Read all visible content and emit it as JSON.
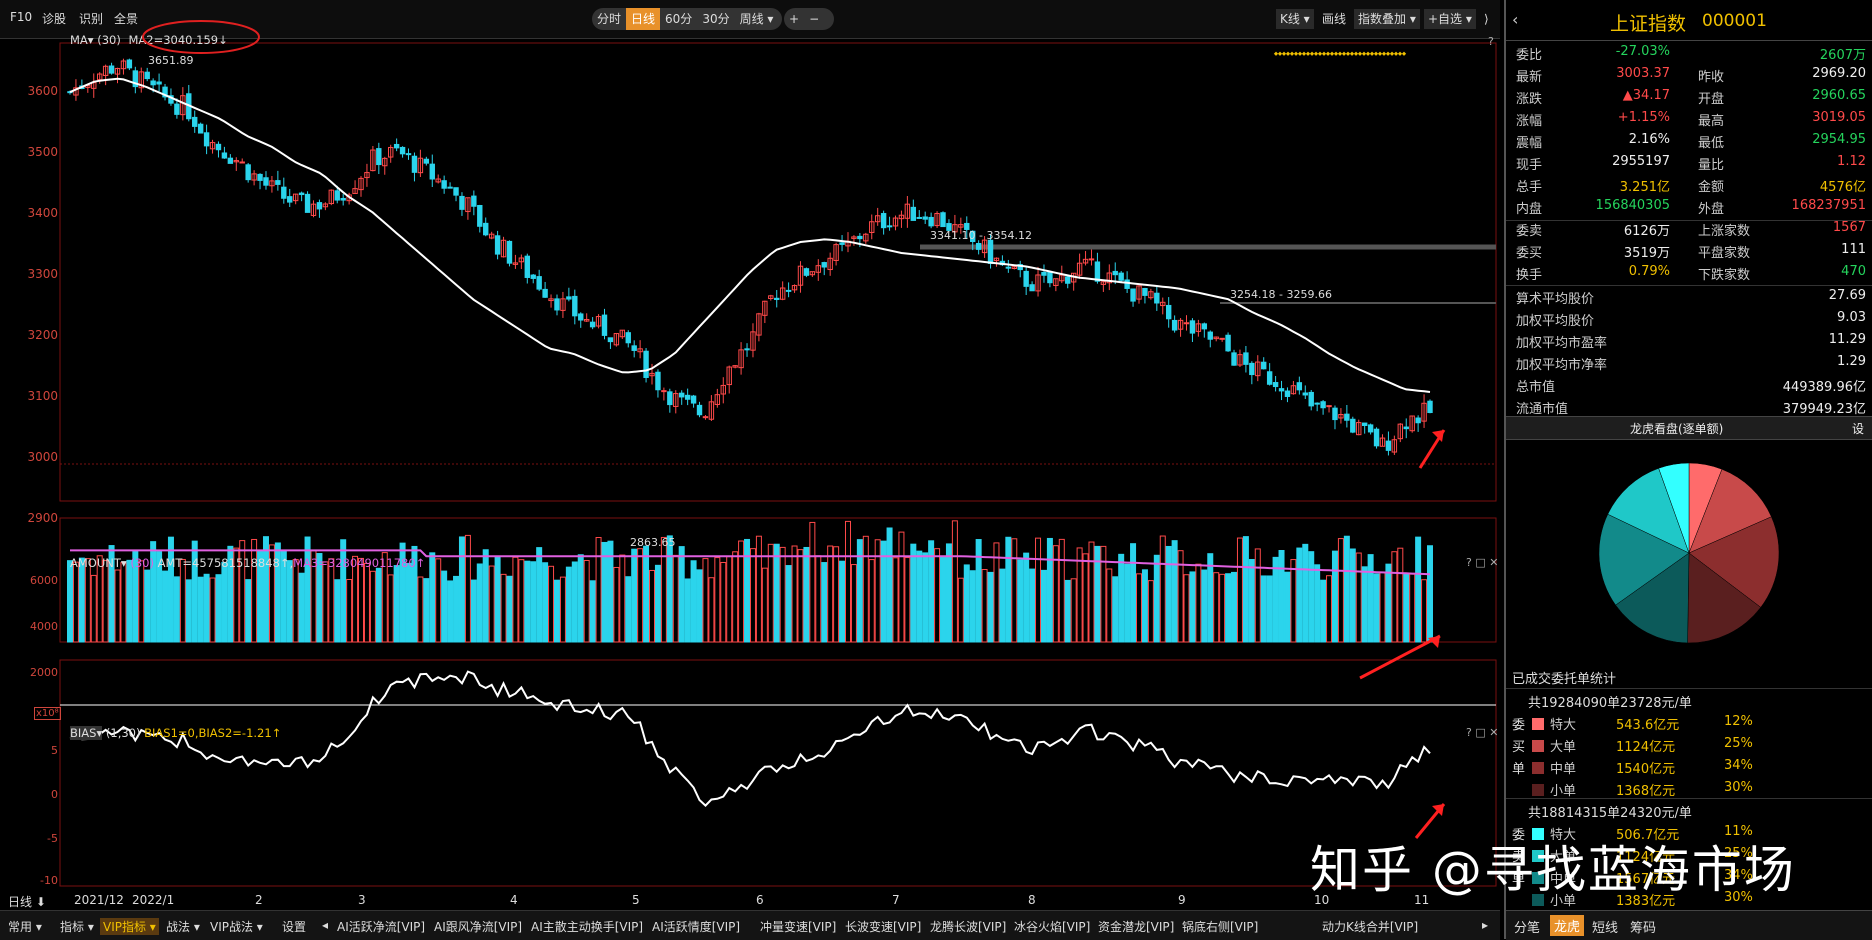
{
  "toolbar": {
    "left": [
      "F10",
      "诊股",
      "识别",
      "全景"
    ],
    "periods": [
      "分时",
      "日线",
      "60分",
      "30分",
      "周线 ▾"
    ],
    "active_period": "日线",
    "zoom_in": "+",
    "zoom_out": "−",
    "right": [
      "K线 ▾",
      "画线",
      "指数叠加 ▾",
      "+自选 ▾"
    ],
    "collapse": "⟩"
  },
  "main_chart": {
    "indicator": "MA▾",
    "param": "(30)",
    "ma2_text": "MA2=3040.159↓",
    "y_labels": [
      "3600",
      "3500",
      "3400",
      "3300",
      "3200",
      "3100",
      "3000",
      "2900"
    ],
    "annotations": {
      "high": "3651.89",
      "low": "2863.65",
      "range1": "3341.10 - 3354.12",
      "range2": "3254.18 - 3259.66"
    },
    "help": "?"
  },
  "amount_panel": {
    "name": "AMOUNT▾",
    "param": "(30)",
    "amt_text": "AMT=457581518848↑,",
    "ma3_text": "MA3=328049011780↑",
    "y_labels": [
      "6000",
      "4000",
      "2000"
    ],
    "unit": "x10⁸",
    "controls": "? □ ✕"
  },
  "bias_panel": {
    "name": "BIAS▾",
    "param": "(1,30)",
    "text": "BIAS1=0,BIAS2=-1.21↑",
    "y_labels": [
      "5",
      "0",
      "-5",
      "-10"
    ],
    "controls": "? □ ✕"
  },
  "x_axis": {
    "period_label": "日线 ⬇",
    "labels": [
      "2021/12",
      "2022/1",
      "2",
      "3",
      "4",
      "5",
      "6",
      "7",
      "8",
      "9",
      "10",
      "11"
    ]
  },
  "bottom_bar": [
    "常用 ▾",
    "指标 ▾",
    "VIP指标 ▾",
    "战法 ▾",
    "VIP战法 ▾",
    "设置",
    "◂",
    "AI活跃净流[VIP]",
    "AI跟风净流[VIP]",
    "AI主散主动换手[VIP]",
    "AI活跃情度[VIP]",
    "冲量变速[VIP]",
    "长波变速[VIP]",
    "龙腾长波[VIP]",
    "冰谷火焰[VIP]",
    "资金潜龙[VIP]",
    "锅底右侧[VIP]",
    "动力K线合并[VIP]",
    "▸"
  ],
  "right_panel": {
    "title": "上证指数",
    "code": "000001",
    "rows": [
      {
        "l1": "委比",
        "v1": "-27.03%",
        "c1": "grn",
        "l2": "",
        "v2": "2607万",
        "c2": "grn"
      },
      {
        "l1": "最新",
        "v1": "3003.37",
        "c1": "red",
        "l2": "昨收",
        "v2": "2969.20",
        "c2": "wht"
      },
      {
        "l1": "涨跌",
        "v1": "▲34.17",
        "c1": "red",
        "l2": "开盘",
        "v2": "2960.65",
        "c2": "grn"
      },
      {
        "l1": "涨幅",
        "v1": "+1.15%",
        "c1": "red",
        "l2": "最高",
        "v2": "3019.05",
        "c2": "red"
      },
      {
        "l1": "震幅",
        "v1": "2.16%",
        "c1": "wht",
        "l2": "最低",
        "v2": "2954.95",
        "c2": "grn"
      },
      {
        "l1": "现手",
        "v1": "2955197",
        "c1": "wht",
        "l2": "量比",
        "v2": "1.12",
        "c2": "red"
      },
      {
        "l1": "总手",
        "v1": "3.251亿",
        "c1": "yel",
        "l2": "金额",
        "v2": "4576亿",
        "c2": "yel"
      },
      {
        "l1": "内盘",
        "v1": "156840305",
        "c1": "grn",
        "l2": "外盘",
        "v2": "168237951",
        "c2": "red"
      },
      {
        "l1": "委卖",
        "v1": "6126万",
        "c1": "wht",
        "l2": "上涨家数",
        "v2": "1567",
        "c2": "red"
      },
      {
        "l1": "委买",
        "v1": "3519万",
        "c1": "wht",
        "l2": "平盘家数",
        "v2": "111",
        "c2": "wht"
      },
      {
        "l1": "换手",
        "v1": "0.79%",
        "c1": "yel",
        "l2": "下跌家数",
        "v2": "470",
        "c2": "grn"
      }
    ],
    "stats": [
      {
        "label": "算术平均股价",
        "value": "27.69"
      },
      {
        "label": "加权平均股价",
        "value": "9.03"
      },
      {
        "label": "加权平均市盈率",
        "value": "11.29"
      },
      {
        "label": "加权平均市净率",
        "value": "1.29"
      },
      {
        "label": "总市值",
        "value": "449389.96亿"
      },
      {
        "label": "流通市值",
        "value": "379949.23亿"
      }
    ],
    "lhb_title": "龙虎看盘(逐单额)",
    "lhb_setting": "设",
    "deal_title": "已成交委托单统计",
    "buy_summary": "共19284090单23728元/单",
    "buy_side": [
      "委",
      "买",
      "单"
    ],
    "buy": [
      {
        "label": "特大",
        "amount": "543.6亿元",
        "pct": "12%",
        "color": "#ff6b6b"
      },
      {
        "label": "大单",
        "amount": "1124亿元",
        "pct": "25%",
        "color": "#c84a4a"
      },
      {
        "label": "中单",
        "amount": "1540亿元",
        "pct": "34%",
        "color": "#8c2e2e"
      },
      {
        "label": "小单",
        "amount": "1368亿元",
        "pct": "30%",
        "color": "#5a1f1f"
      }
    ],
    "sell_summary": "共18814315单24320元/单",
    "sell_side": [
      "委",
      "卖",
      "单"
    ],
    "sell": [
      {
        "label": "特大",
        "amount": "506.7亿元",
        "pct": "11%",
        "color": "#33ffff"
      },
      {
        "label": "大单",
        "amount": "1124亿元",
        "pct": "25%",
        "color": "#1fc8c8"
      },
      {
        "label": "中单",
        "amount": "1567亿元",
        "pct": "34%",
        "color": "#128a8a"
      },
      {
        "label": "小单",
        "amount": "1383亿元",
        "pct": "30%",
        "color": "#0c5a5a"
      }
    ],
    "tabs": [
      "分笔",
      "龙虎",
      "短线",
      "筹码"
    ],
    "active_tab": "龙虎"
  },
  "watermark": "知乎 @寻找蓝海市场",
  "colors": {
    "up": "#ff4a4a",
    "down": "#2bd4ec",
    "ma": "#ffffff",
    "ma3": "#e060e0",
    "accent": "#e8912a"
  },
  "chart_data": [
    {
      "type": "candlestick",
      "title": "",
      "ylim": [
        2840,
        3680
      ],
      "x_start_label": "2021/12",
      "x_end_label": "11",
      "values_close": [
        3590,
        3620,
        3640,
        3610,
        3580,
        3560,
        3500,
        3470,
        3430,
        3400,
        3380,
        3390,
        3420,
        3470,
        3480,
        3450,
        3420,
        3380,
        3320,
        3280,
        3240,
        3200,
        3170,
        3150,
        3120,
        3060,
        3020,
        3000,
        3080,
        3130,
        3220,
        3250,
        3280,
        3300,
        3340,
        3360,
        3370,
        3360,
        3330,
        3300,
        3260,
        3240,
        3240,
        3270,
        3260,
        3230,
        3210,
        3170,
        3150,
        3130,
        3090,
        3070,
        3050,
        3010,
        3000,
        2970,
        2940,
        2990,
        3003
      ],
      "ma": [
        3590,
        3610,
        3615,
        3600,
        3580,
        3560,
        3540,
        3510,
        3490,
        3460,
        3440,
        3400,
        3370,
        3330,
        3290,
        3250,
        3210,
        3180,
        3150,
        3120,
        3110,
        3090,
        3075,
        3080,
        3110,
        3160,
        3210,
        3260,
        3300,
        3315,
        3320,
        3315,
        3305,
        3295,
        3290,
        3285,
        3280,
        3275,
        3270,
        3260,
        3250,
        3245,
        3240,
        3235,
        3230,
        3220,
        3210,
        3185,
        3165,
        3140,
        3110,
        3085,
        3065,
        3045,
        3040
      ]
    },
    {
      "type": "bar",
      "title": "AMOUNT",
      "ylim": [
        0,
        6500
      ],
      "unit": "x10⁸"
    },
    {
      "type": "line",
      "title": "BIAS",
      "ylim": [
        -12,
        6
      ]
    }
  ]
}
